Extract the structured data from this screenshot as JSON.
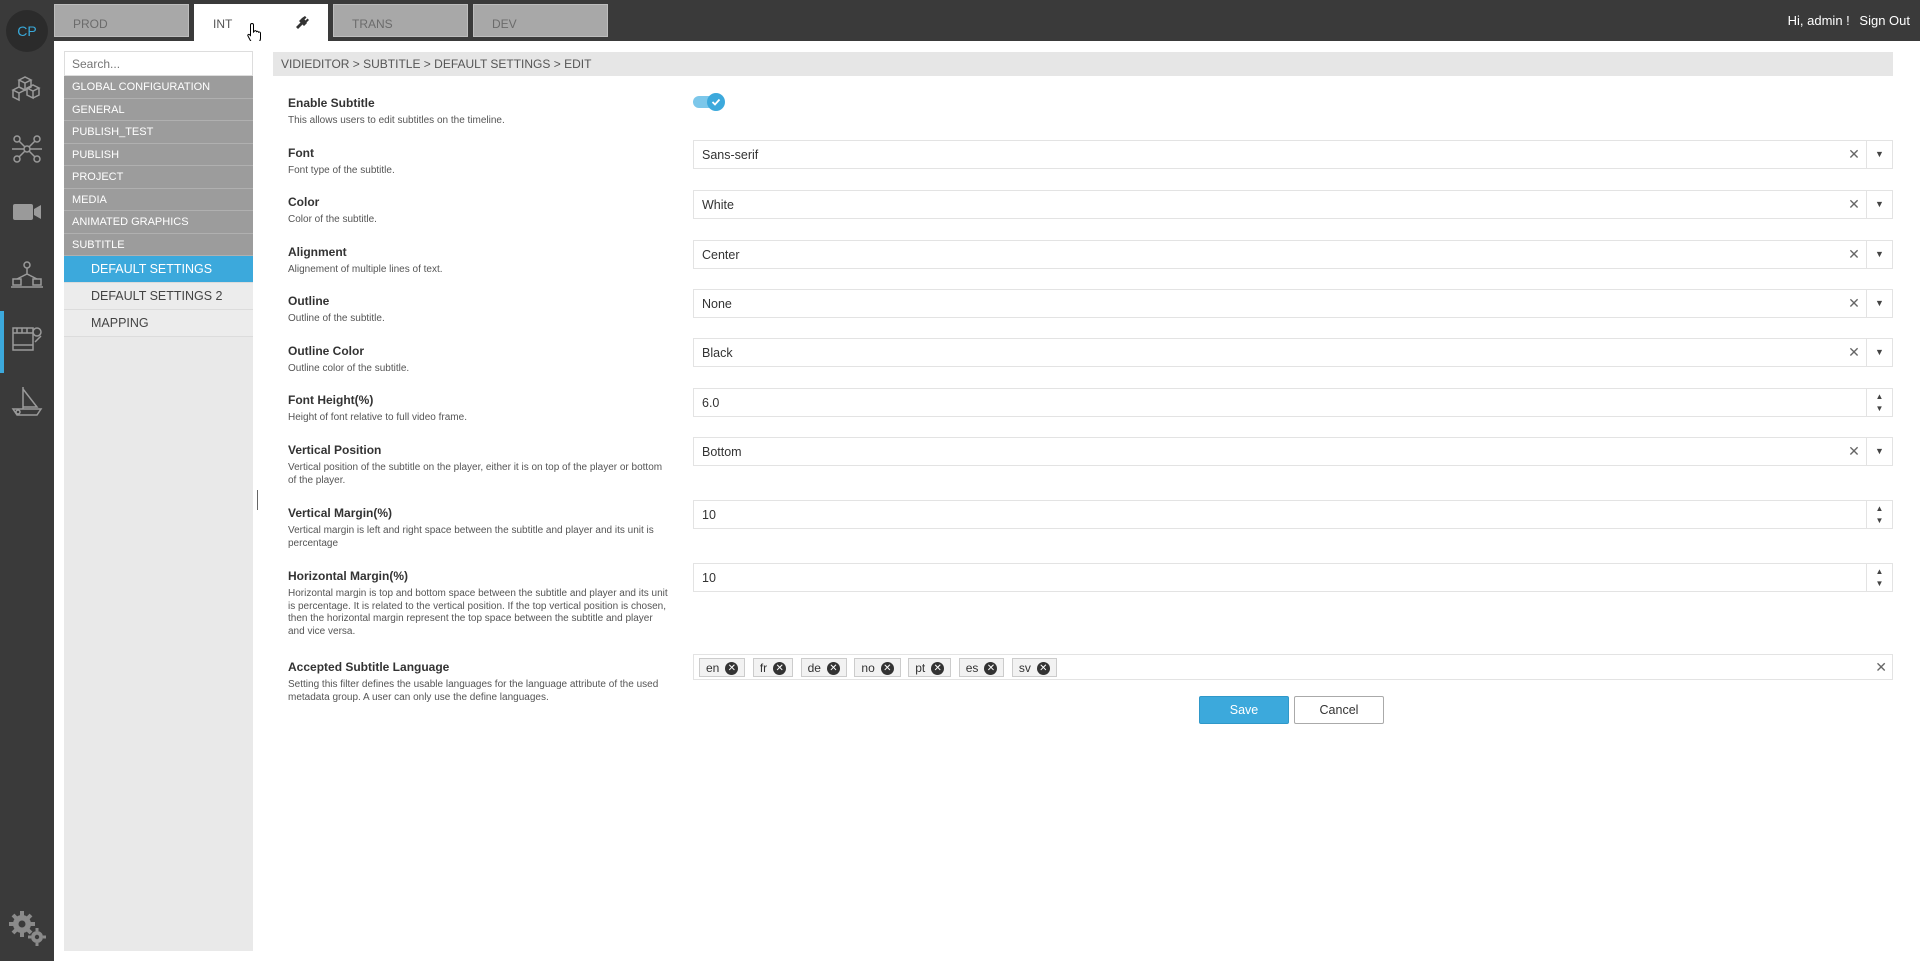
{
  "rail": {
    "logo": "CP",
    "icons": [
      "cubes-icon",
      "network-icon",
      "video-camera-icon",
      "workflow-icon",
      "film-settings-icon",
      "ship-icon"
    ],
    "settings_icon": "gear-icon"
  },
  "tabs": [
    "PROD",
    "INT",
    "TRANS",
    "DEV"
  ],
  "user": {
    "greeting": "Hi, admin !",
    "signout": "Sign Out"
  },
  "nav": {
    "search_placeholder": "Search...",
    "groups": [
      "GLOBAL CONFIGURATION",
      "GENERAL",
      "PUBLISH_TEST",
      "PUBLISH",
      "PROJECT",
      "MEDIA",
      "ANIMATED GRAPHICS",
      "SUBTITLE"
    ],
    "sub_items": [
      "DEFAULT SETTINGS",
      "DEFAULT SETTINGS 2",
      "MAPPING"
    ]
  },
  "breadcrumb": "VIDIEDITOR > SUBTITLE > DEFAULT SETTINGS > EDIT",
  "form": {
    "enable": {
      "label": "Enable Subtitle",
      "desc": "This allows users to edit subtitles on the timeline.",
      "value": "on"
    },
    "font": {
      "label": "Font",
      "desc": "Font type of the subtitle.",
      "value": "Sans-serif"
    },
    "color": {
      "label": "Color",
      "desc": "Color of the subtitle.",
      "value": "White"
    },
    "alignment": {
      "label": "Alignment",
      "desc": "Alignement of multiple lines of text.",
      "value": "Center"
    },
    "outline": {
      "label": "Outline",
      "desc": "Outline of the subtitle.",
      "value": "None"
    },
    "outline_color": {
      "label": "Outline Color",
      "desc": "Outline color of the subtitle.",
      "value": "Black"
    },
    "font_height": {
      "label": "Font Height(%)",
      "desc": "Height of font relative to full video frame.",
      "value": "6.0"
    },
    "vertical_position": {
      "label": "Vertical Position",
      "desc": "Vertical position of the subtitle on the player, either it is on top of the player or bottom of the player.",
      "value": "Bottom"
    },
    "vertical_margin": {
      "label": "Vertical Margin(%)",
      "desc": "Vertical margin is left and right space between the subtitle and player and its unit is percentage",
      "value": "10"
    },
    "horizontal_margin": {
      "label": "Horizontal Margin(%)",
      "desc": "Horizontal margin is top and bottom space between the subtitle and player and its unit is percentage. It is related to the vertical position. If the top vertical position is chosen, then the horizontal margin represent the top space between the subtitle and player and vice versa.",
      "value": "10"
    },
    "languages": {
      "label": "Accepted Subtitle Language",
      "desc": "Setting this filter defines the usable languages for the language attribute of the used metadata group. A user can only use the define languages.",
      "tags": [
        "en",
        "fr",
        "de",
        "no",
        "pt",
        "es",
        "sv"
      ]
    }
  },
  "actions": {
    "save": "Save",
    "cancel": "Cancel"
  },
  "colors": {
    "accent": "#3ca9dc",
    "rail": "#3a3a3a",
    "nav_group": "#9c9c9c"
  }
}
